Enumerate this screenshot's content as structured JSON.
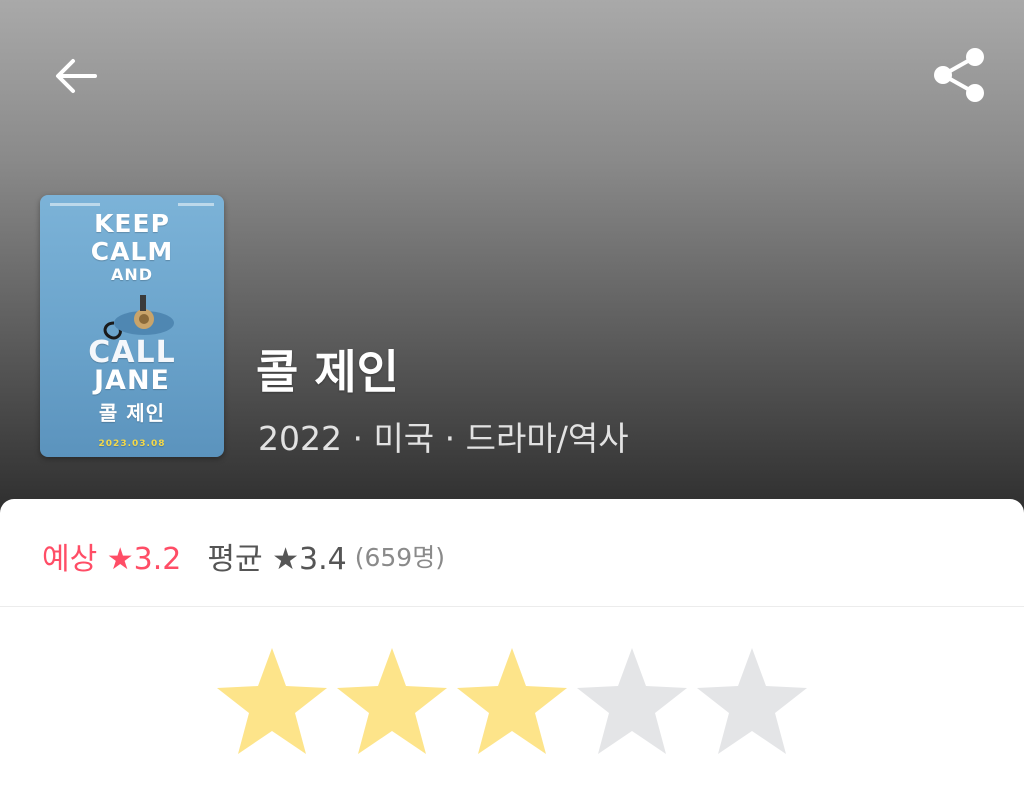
{
  "header": {
    "back_icon": "arrow-left-icon",
    "share_icon": "share-icon"
  },
  "poster": {
    "lines": [
      "KEEP",
      "CALM",
      "AND",
      "CALL",
      "JANE",
      "콜 제인",
      "",
      "2023.03.08"
    ]
  },
  "movie": {
    "title": "콜 제인",
    "meta": "2022 · 미국 · 드라마/역사"
  },
  "ratings": {
    "expected_label": "예상",
    "expected_value": "★3.2",
    "average_label": "평균",
    "average_value": "★3.4",
    "count": "(659명)",
    "accent_color": "#ff4d66"
  },
  "user_rating": {
    "max": 5,
    "selected": 3,
    "filled_color": "#fde48a",
    "empty_color": "#e4e5e7"
  }
}
